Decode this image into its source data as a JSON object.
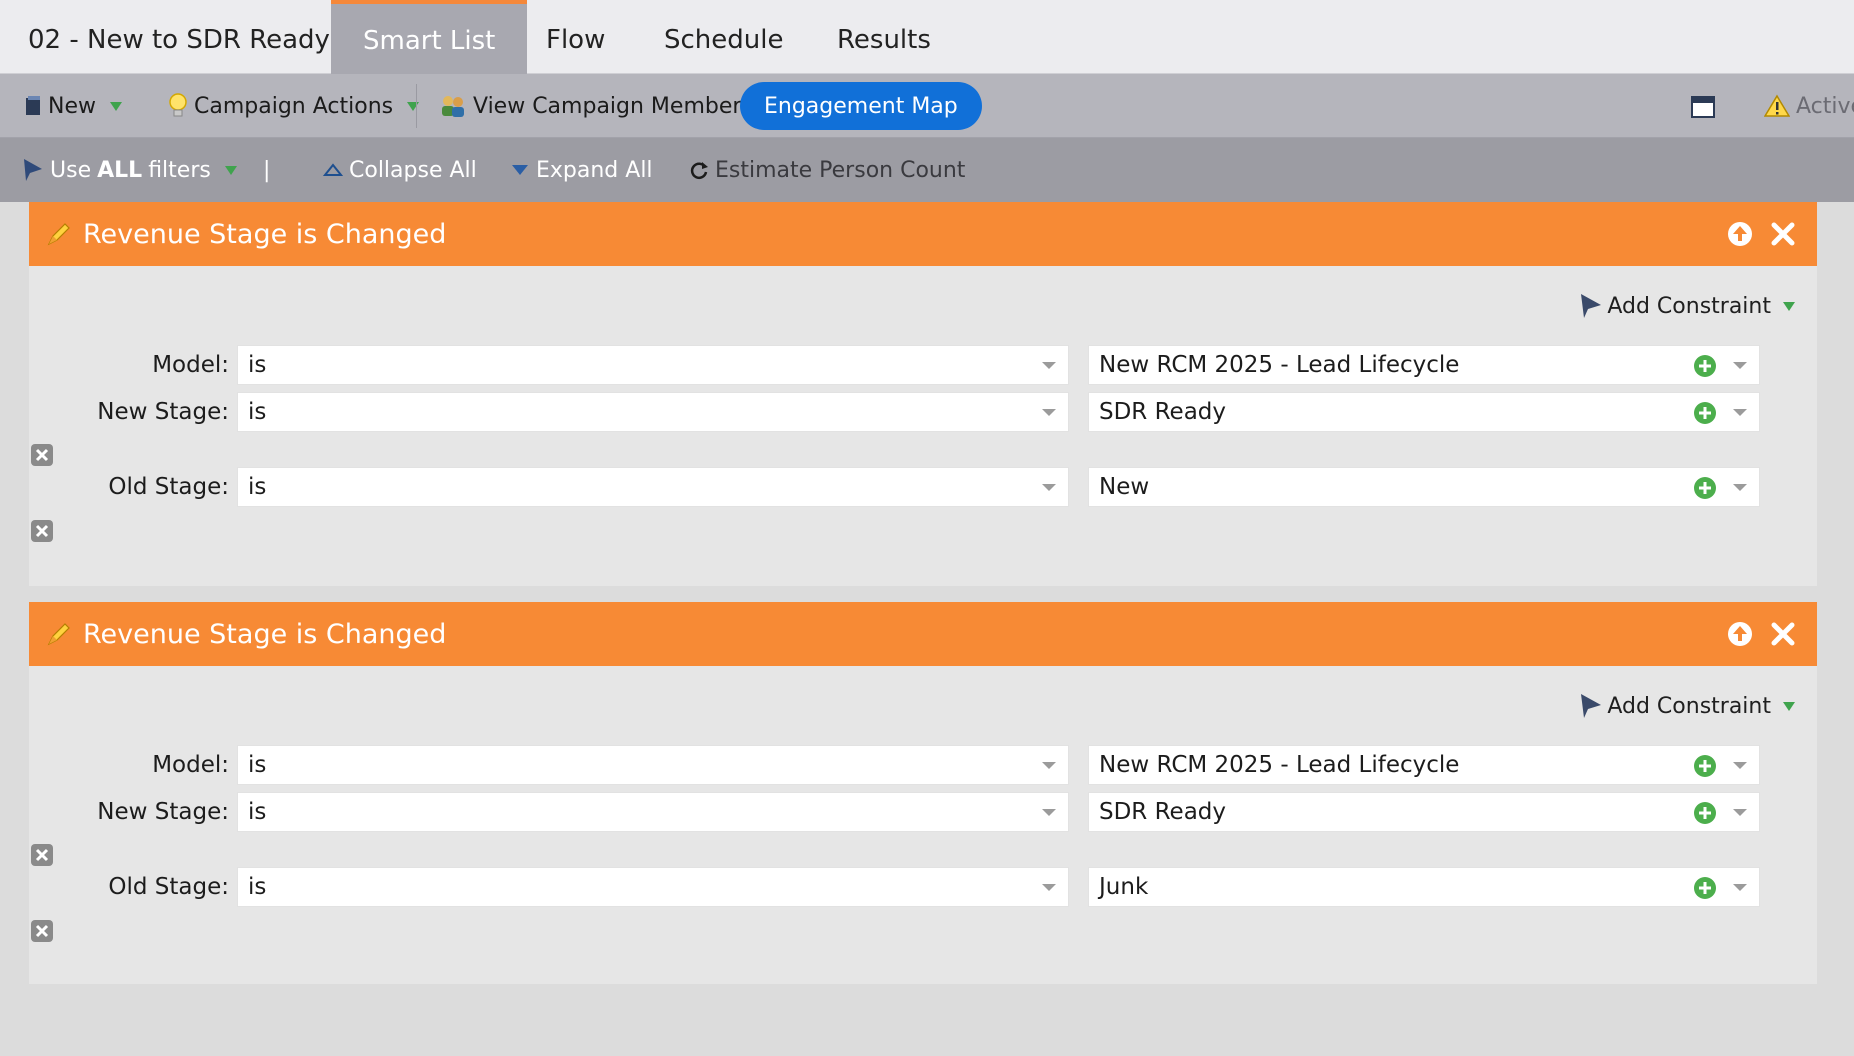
{
  "tabs": {
    "title": "02 - New to SDR Ready",
    "items": [
      {
        "label": "Smart List",
        "active": true
      },
      {
        "label": "Flow",
        "active": false
      },
      {
        "label": "Schedule",
        "active": false
      },
      {
        "label": "Results",
        "active": false
      }
    ]
  },
  "toolbar": {
    "new_label": "New",
    "campaign_actions_label": "Campaign Actions",
    "view_members_label": "View Campaign Members",
    "engagement_map_label": "Engagement Map",
    "status_label": "Active"
  },
  "filterbar": {
    "use_filters_prefix": "Use",
    "use_filters_bold": "ALL",
    "use_filters_suffix": "filters",
    "separator": "|",
    "collapse_label": "Collapse All",
    "expand_label": "Expand All",
    "estimate_label": "Estimate Person Count"
  },
  "filters": [
    {
      "title": "Revenue Stage is Changed",
      "add_constraint": "Add Constraint",
      "rows": [
        {
          "label": "Model:",
          "operator": "is",
          "value": "New RCM 2025 - Lead Lifecycle"
        },
        {
          "label": "New Stage:",
          "operator": "is",
          "value": "SDR Ready"
        },
        {
          "label": "Old Stage:",
          "operator": "is",
          "value": "New"
        }
      ]
    },
    {
      "title": "Revenue Stage is Changed",
      "add_constraint": "Add Constraint",
      "rows": [
        {
          "label": "Model:",
          "operator": "is",
          "value": "New RCM 2025 - Lead Lifecycle"
        },
        {
          "label": "New Stage:",
          "operator": "is",
          "value": "SDR Ready"
        },
        {
          "label": "Old Stage:",
          "operator": "is",
          "value": "Junk"
        }
      ]
    }
  ],
  "colors": {
    "accent_orange": "#f78a35",
    "pill_blue": "#1170d8",
    "green_plus": "#3fa34d"
  }
}
